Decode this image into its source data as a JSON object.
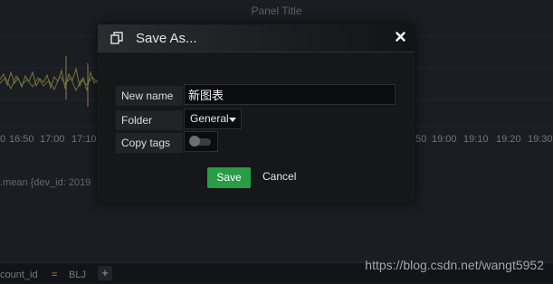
{
  "panel": {
    "title": "Panel Title",
    "x_ticks": [
      "0",
      "16:50",
      "17:00",
      "17:10",
      "50",
      "19:00",
      "19:10",
      "19:20",
      "19:30"
    ],
    "legend_fragment": ".mean {dev_id: 2019",
    "line_color": "#a08a45"
  },
  "bottom_bar": {
    "variable_fragment": "count_id",
    "operator": "=",
    "value": "BLJ",
    "add_symbol": "+"
  },
  "watermark": "https://blog.csdn.net/wangt5952",
  "dialog": {
    "title": "Save As...",
    "fields": {
      "name_label": "New name",
      "name_value": "新图表",
      "folder_label": "Folder",
      "folder_value": "General",
      "copy_tags_label": "Copy tags",
      "copy_tags_enabled": false
    },
    "save_label": "Save",
    "cancel_label": "Cancel",
    "accent_color": "#299c46"
  }
}
